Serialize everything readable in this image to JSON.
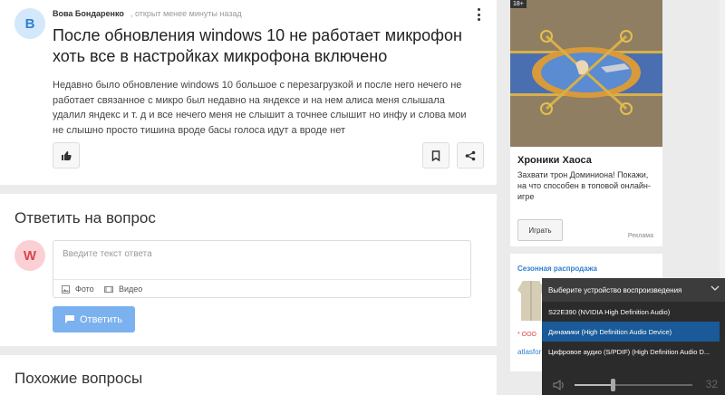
{
  "question": {
    "avatar_letter": "В",
    "author": "Вова Бондаренко",
    "meta": ", открыт менее минуты назад",
    "title": "После обновления windows 10 не работает микрофон хоть все в настройках микрофона включено",
    "body": "Недавно было обновление windows 10 большое с перезагрузкой и после него нечего не работает связанное с микро был недавно на яндексе и на нем алиса меня слышала удалил яндекс и т. д и все нечего меня не слышит а точнее слышит но инфу и слова мои не слышно просто тишина вроде басы голоса идут а вроде нет"
  },
  "reply": {
    "heading": "Ответить на вопрос",
    "avatar_letter": "W",
    "placeholder": "Введите текст ответа",
    "photo_label": "Фото",
    "video_label": "Видео",
    "submit_label": "Ответить"
  },
  "similar": {
    "heading": "Похожие вопросы"
  },
  "ad1": {
    "age": "18+",
    "title": "Хроники Хаоса",
    "desc": "Захвати трон Доминиона! Покажи, на что способен в топовой онлайн-игре",
    "play": "Играть",
    "label": "Реклама"
  },
  "ad2": {
    "title": "Сезонная распродажа",
    "seller": "* ООО",
    "link": "atlasfor"
  },
  "audio_panel": {
    "header": "Выберите устройство воспроизведения",
    "devices": [
      "S22E390 (NVIDIA High Definition Audio)",
      "Динамики (High Definition Audio Device)",
      "Цифровое аудио (S/PDIF) (High Definition Audio D..."
    ],
    "selected_index": 1,
    "volume": 32
  },
  "colors": {
    "accent": "#2f7fce",
    "button": "#7bb1ef",
    "selected_device": "#1a5a99"
  }
}
